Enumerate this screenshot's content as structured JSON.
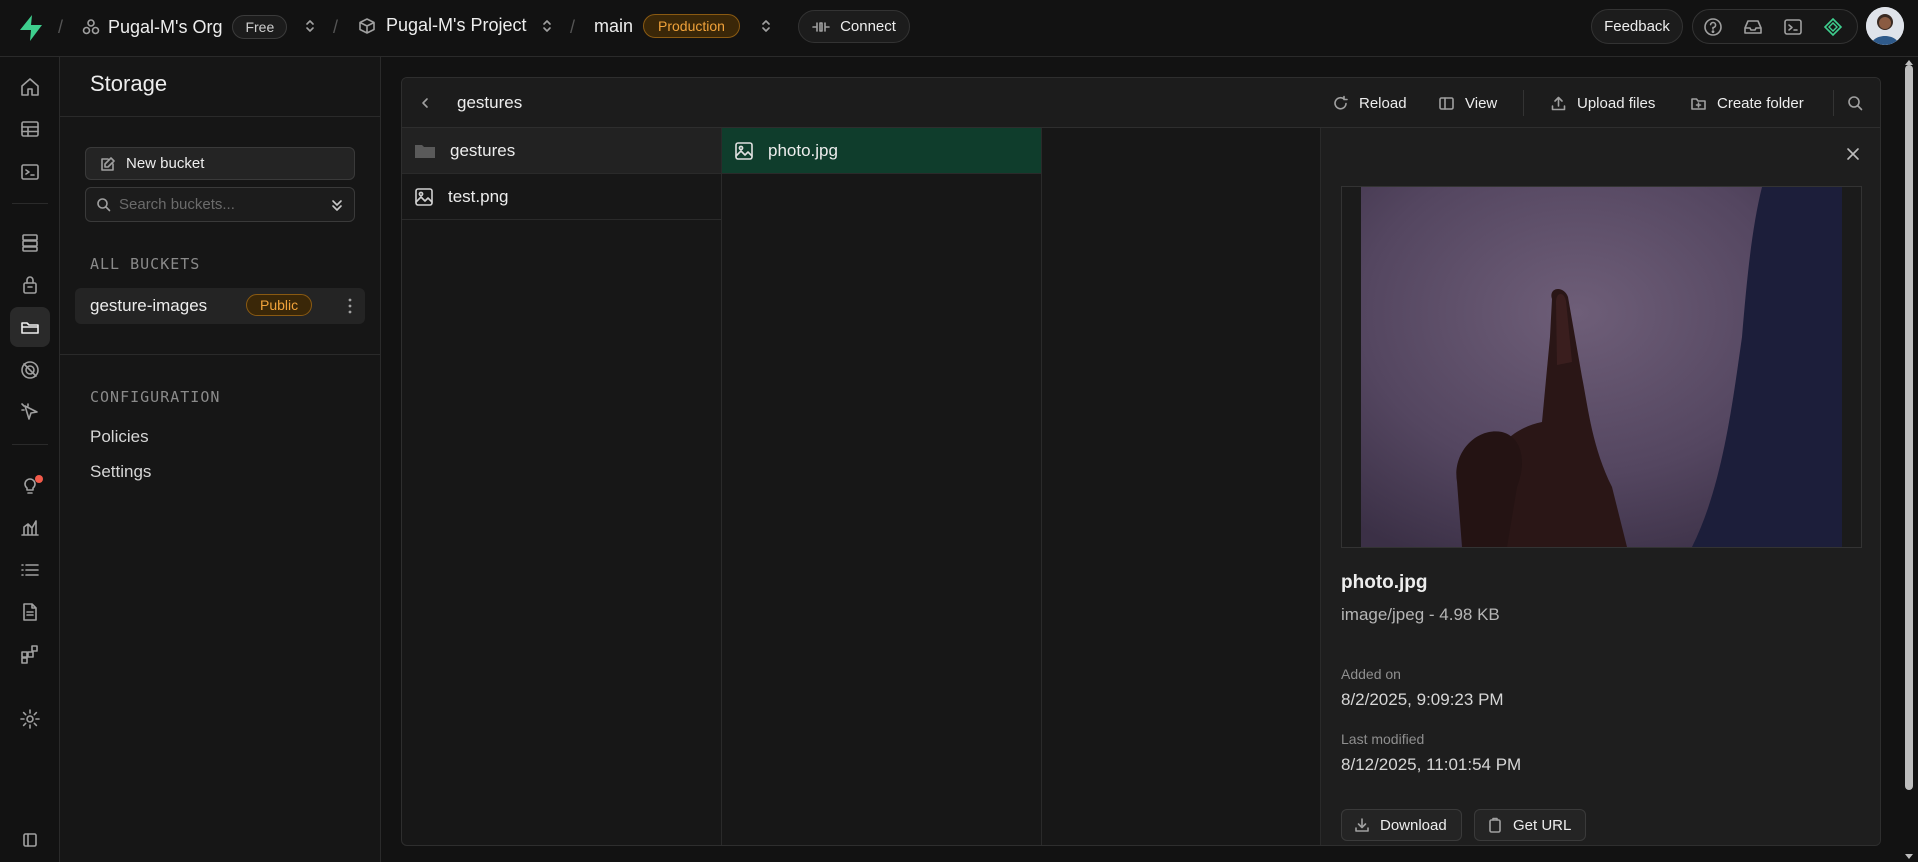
{
  "topbar": {
    "org_name": "Pugal-M's Org",
    "org_plan": "Free",
    "project_name": "Pugal-M's Project",
    "branch": "main",
    "env_badge": "Production",
    "connect_label": "Connect",
    "feedback_label": "Feedback"
  },
  "sidebar": {
    "title": "Storage",
    "new_bucket_label": "New bucket",
    "search_placeholder": "Search buckets...",
    "all_buckets_label": "ALL BUCKETS",
    "buckets": [
      {
        "name": "gesture-images",
        "badge": "Public"
      }
    ],
    "configuration_label": "CONFIGURATION",
    "config_links": [
      "Policies",
      "Settings"
    ]
  },
  "explorer": {
    "current_folder": "gestures",
    "toolbar": {
      "reload_label": "Reload",
      "view_label": "View",
      "upload_label": "Upload files",
      "create_folder_label": "Create folder"
    },
    "column1": [
      {
        "name": "gestures",
        "type": "folder"
      },
      {
        "name": "test.png",
        "type": "image"
      }
    ],
    "column2": [
      {
        "name": "photo.jpg",
        "type": "image",
        "selected": true
      }
    ]
  },
  "preview": {
    "file_name": "photo.jpg",
    "meta": "image/jpeg - 4.98 KB",
    "added_label": "Added on",
    "added_value": "8/2/2025, 9:09:23 PM",
    "modified_label": "Last modified",
    "modified_value": "8/12/2025, 11:01:54 PM",
    "download_label": "Download",
    "get_url_label": "Get URL"
  },
  "colors": {
    "accent_green": "#3ecf8e",
    "selected_row": "#0f3d2c",
    "badge_orange": "#f0a23a",
    "notification_dot": "#f25a4a"
  },
  "icons": {
    "rail": [
      "home-icon",
      "table-editor-icon",
      "sql-editor-icon",
      "database-icon",
      "auth-icon",
      "storage-icon",
      "edge-functions-icon",
      "realtime-icon",
      "advisors-icon",
      "reports-icon",
      "logs-icon",
      "api-docs-icon",
      "integrations-icon",
      "settings-icon",
      "collapse-sidebar-icon"
    ]
  }
}
